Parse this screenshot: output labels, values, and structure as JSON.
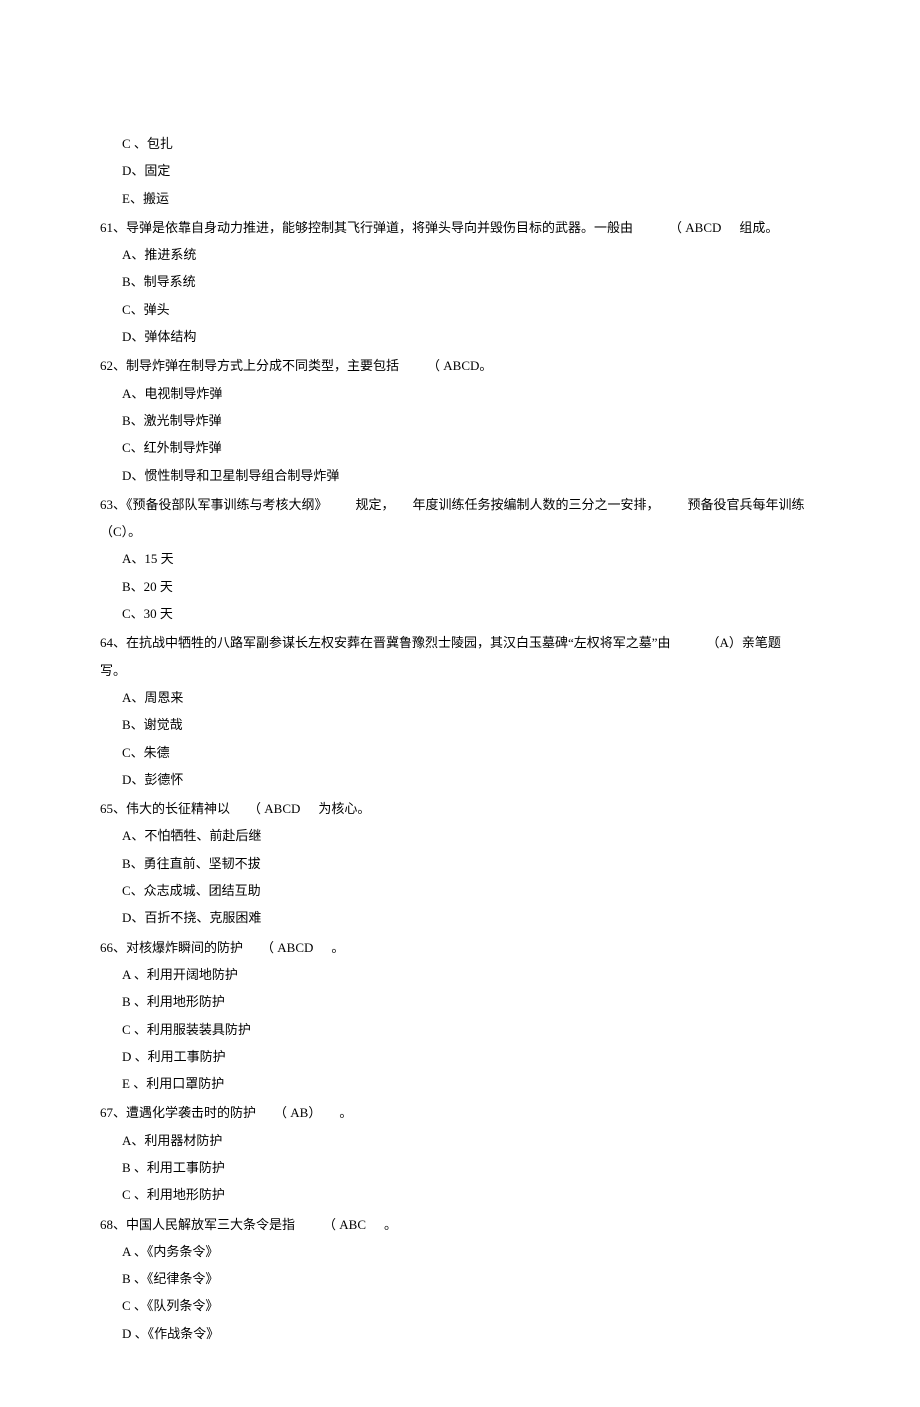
{
  "preOptions": [
    "C 、包扎",
    "D、固定",
    "E、搬运"
  ],
  "questions": [
    {
      "num": "61",
      "stemParts": [
        "导弹是依靠自身动力推进，能够控制其飞行弹道，将弹头导向并毁伤目标的武器。一般由",
        "（ ABCD",
        "组成。"
      ],
      "gaps": [
        "g2",
        "g3"
      ],
      "options": [
        "A、推进系统",
        "B、制导系统",
        "C、弹头",
        "D、弹体结构"
      ]
    },
    {
      "num": "62",
      "stemParts": [
        "制导炸弹在制导方式上分成不同类型，主要包括",
        "（ ABCD。"
      ],
      "gaps": [
        "g1"
      ],
      "options": [
        "A、电视制导炸弹",
        "B、激光制导炸弹",
        "C、红外制导炸弹",
        "D、惯性制导和卫星制导组合制导炸弹"
      ]
    },
    {
      "num": "63",
      "stemParts": [
        "《预备役部队军事训练与考核大纲》",
        "规定，",
        "年度训练任务按编制人数的三分之一安排，",
        "预备役官兵每年训练",
        "（C）。"
      ],
      "gaps": [
        "g1",
        "g3",
        "g1",
        "g3"
      ],
      "options": [
        "A、15 天",
        "B、20 天",
        "C、30 天"
      ]
    },
    {
      "num": "64",
      "stemParts": [
        "在抗战中牺牲的八路军副参谋长左权安葬在晋冀鲁豫烈士陵园，其汉白玉墓碑“左权将军之墓”由",
        "（A）亲笔题"
      ],
      "gaps": [
        "g2"
      ],
      "cont": "写。",
      "options": [
        "A、周恩来",
        "B、谢觉哉",
        "C、朱德",
        "D、彭德怀"
      ]
    },
    {
      "num": "65",
      "stemParts": [
        "伟大的长征精神以",
        "（ ABCD",
        "为核心。"
      ],
      "gaps": [
        "g3",
        "g3"
      ],
      "options": [
        "A、不怕牺牲、前赴后继",
        "B、勇往直前、坚韧不拔",
        "C、众志成城、团结互助",
        "D、百折不挠、克服困难"
      ]
    },
    {
      "num": "66",
      "stemParts": [
        "对核爆炸瞬间的防护",
        "（ ABCD",
        "。"
      ],
      "gaps": [
        "g3",
        "g3"
      ],
      "options": [
        "A 、利用开阔地防护",
        "B 、利用地形防护",
        "C 、利用服装装具防护",
        "D 、利用工事防护",
        "E 、利用口罩防护"
      ]
    },
    {
      "num": "67",
      "stemParts": [
        "遭遇化学袭击时的防护",
        "（ AB）",
        "。"
      ],
      "gaps": [
        "g3",
        "g3"
      ],
      "options": [
        "A、利用器材防护",
        "B 、利用工事防护",
        "C 、利用地形防护"
      ]
    },
    {
      "num": "68",
      "stemParts": [
        "中国人民解放军三大条令是指",
        "（ ABC",
        "。"
      ],
      "gaps": [
        "g1",
        "g3"
      ],
      "options": [
        "A 、《内务条令》",
        "B 、《纪律条令》",
        "C 、《队列条令》",
        "D 、《作战条令》"
      ]
    }
  ]
}
